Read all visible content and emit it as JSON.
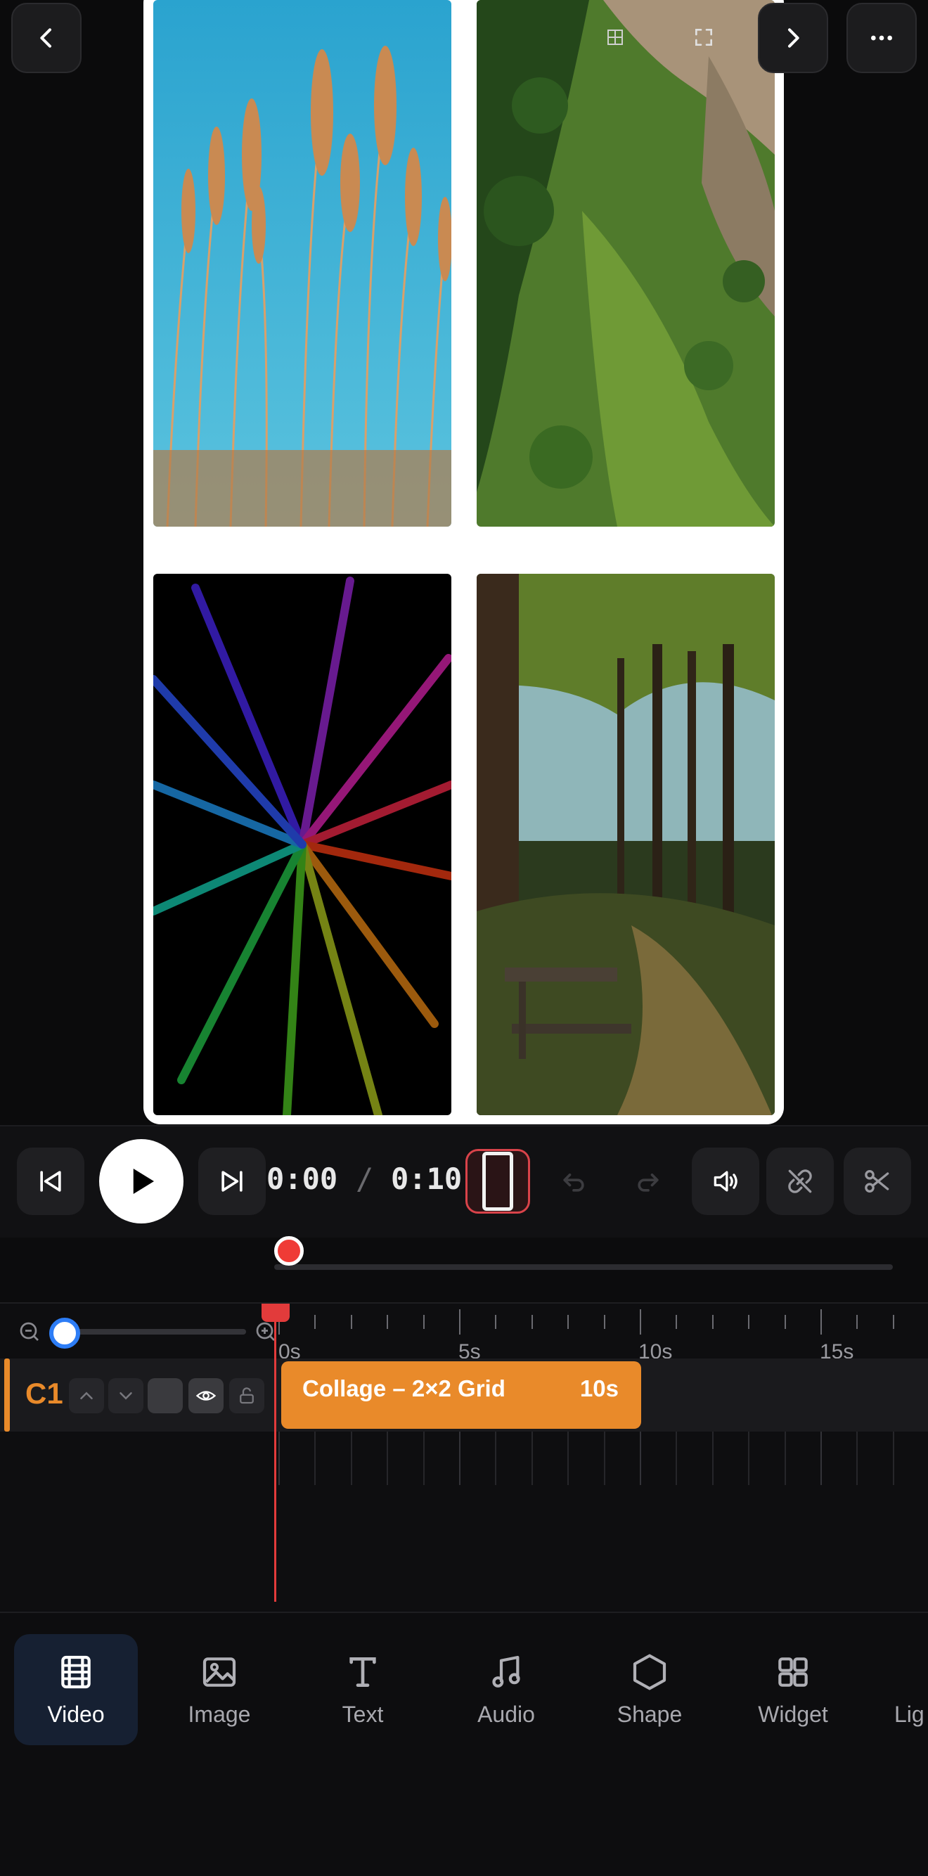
{
  "preview": {
    "cells": [
      {
        "icon": "wheat-grass-photo"
      },
      {
        "icon": "aerial-forest-photo"
      },
      {
        "icon": "rainbow-rays-photo"
      },
      {
        "icon": "forest-path-photo"
      }
    ]
  },
  "top_bar": {
    "back_icon": "chevron-left-icon",
    "grid_icon": "grid-icon",
    "fullscreen_icon": "expand-icon",
    "next_icon": "chevron-right-icon",
    "more_icon": "more-horizontal-icon"
  },
  "playback": {
    "current_time": "0:00",
    "separator": "/",
    "total_time": "0:10"
  },
  "timeline": {
    "ruler": [
      "0s",
      "5s",
      "10s",
      "15s"
    ],
    "track": {
      "name": "C1",
      "clip_title": "Collage – 2×2 Grid",
      "clip_duration": "10s"
    },
    "zoom_level": 0.05
  },
  "toolbar": {
    "items": [
      {
        "label": "Video",
        "icon": "film-icon",
        "active": true
      },
      {
        "label": "Image",
        "icon": "image-icon",
        "active": false
      },
      {
        "label": "Text",
        "icon": "text-icon",
        "active": false
      },
      {
        "label": "Audio",
        "icon": "music-note-icon",
        "active": false
      },
      {
        "label": "Shape",
        "icon": "hexagon-icon",
        "active": false
      },
      {
        "label": "Widget",
        "icon": "widget-grid-icon",
        "active": false
      },
      {
        "label": "Lig",
        "icon": "light-icon",
        "active": false
      }
    ]
  },
  "colors": {
    "accent": "#e98a2a",
    "playhead": "#e23b3b",
    "zoom_knob": "#2d7df6",
    "active_tool_bg": "#162032"
  }
}
